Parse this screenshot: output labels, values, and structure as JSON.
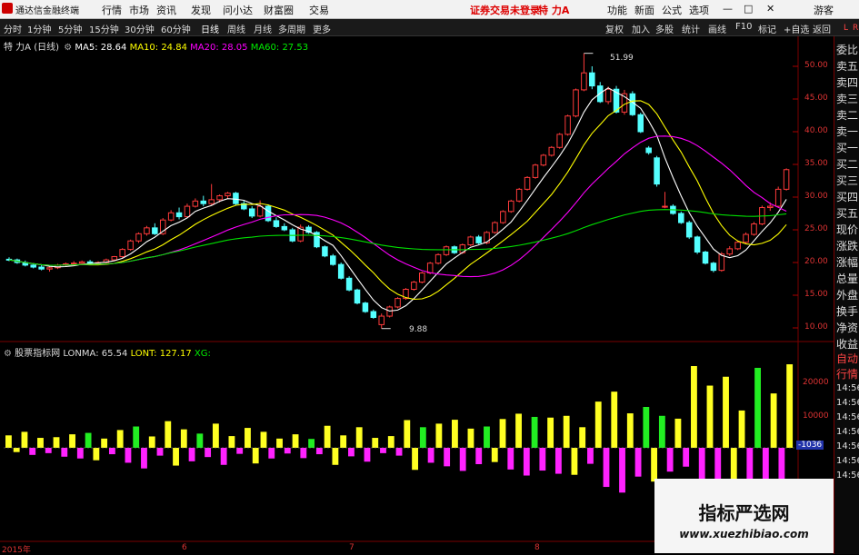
{
  "menubar": {
    "logo_text": "通达信金融终端",
    "items": [
      "行情",
      "市场",
      "资讯",
      "发现",
      "问小达",
      "财富圈",
      "交易"
    ],
    "notice": "证券交易未登录",
    "stock": "特 力A",
    "right_items": [
      "功能",
      "新面",
      "公式",
      "选项"
    ],
    "window_buttons": [
      "—",
      "□",
      "✕"
    ],
    "guest": "游客"
  },
  "toolbar": {
    "periods": [
      "分时",
      "1分钟",
      "5分钟",
      "15分钟",
      "30分钟",
      "60分钟",
      "日线",
      "周线",
      "月线",
      "多周期",
      "更多"
    ],
    "selected": "日线",
    "right_items": [
      "复权",
      "加入",
      "多股",
      "统计",
      "画线",
      "F10",
      "标记",
      "+自选",
      "返回"
    ]
  },
  "main_chart": {
    "stock_label": "特 力A",
    "period_label": "(日线)",
    "ma": [
      {
        "label": "MA5: 28.64",
        "color": "#ffffff"
      },
      {
        "label": "MA10: 24.84",
        "color": "#ffff00"
      },
      {
        "label": "MA20: 28.05",
        "color": "#ff00ff"
      },
      {
        "label": "MA60: 27.53",
        "color": "#00e000"
      }
    ],
    "y_ticks": [
      "50.00",
      "45.00",
      "40.00",
      "35.00",
      "30.00",
      "25.00",
      "20.00",
      "15.00",
      "10.00"
    ],
    "high_label": "51.99",
    "low_label": "9.88"
  },
  "indicator": {
    "name": "股票指标网",
    "lonma_label": "LONMA: 65.54",
    "lont_label": "LONT: 127.17",
    "xg_label": "XG:",
    "y_ticks": [
      "20000",
      "10000"
    ],
    "current_value": "-1036"
  },
  "x_labels": [
    "2015年",
    "6",
    "7",
    "8"
  ],
  "right_panel": {
    "top_letters": [
      "L",
      "R"
    ],
    "items": [
      "委比",
      "卖五",
      "卖四",
      "卖三",
      "卖二",
      "卖一",
      "买一",
      "买二",
      "买三",
      "买四",
      "买五",
      "现价",
      "涨跌",
      "涨幅",
      "总量",
      "外盘",
      "换手",
      "净资",
      "收益",
      "自动",
      "行情"
    ],
    "times": [
      "14:56",
      "14:56",
      "14:56",
      "14:56",
      "14:56",
      "14:56",
      "14:56"
    ]
  },
  "watermark": {
    "title": "指标严选网",
    "url": "www.xuezhibiao.com"
  },
  "chart_data": {
    "type": "candlestick",
    "price_range": [
      9.0,
      53.0
    ],
    "candles": [
      [
        20.5,
        20.8,
        20.2,
        20.4
      ],
      [
        20.4,
        20.6,
        19.8,
        20.0
      ],
      [
        20.0,
        20.3,
        19.4,
        19.6
      ],
      [
        19.6,
        19.9,
        19.1,
        19.3
      ],
      [
        19.3,
        19.6,
        18.8,
        19.0
      ],
      [
        19.0,
        19.4,
        18.6,
        19.2
      ],
      [
        19.2,
        19.8,
        19.0,
        19.6
      ],
      [
        19.6,
        20.0,
        19.4,
        19.8
      ],
      [
        19.8,
        20.2,
        19.5,
        19.9
      ],
      [
        19.9,
        20.3,
        19.6,
        20.1
      ],
      [
        20.1,
        20.4,
        19.7,
        19.9
      ],
      [
        19.9,
        20.2,
        19.6,
        20.0
      ],
      [
        20.0,
        20.6,
        19.8,
        20.4
      ],
      [
        20.4,
        21.0,
        20.2,
        20.9
      ],
      [
        20.9,
        22.2,
        20.7,
        22.0
      ],
      [
        22.0,
        23.5,
        21.8,
        23.3
      ],
      [
        23.3,
        24.6,
        23.0,
        24.4
      ],
      [
        24.4,
        25.6,
        24.1,
        25.3
      ],
      [
        25.3,
        26.0,
        24.2,
        24.4
      ],
      [
        24.4,
        26.8,
        24.2,
        26.5
      ],
      [
        26.5,
        28.0,
        26.3,
        27.6
      ],
      [
        27.6,
        28.4,
        26.6,
        27.0
      ],
      [
        27.0,
        29.0,
        26.8,
        28.6
      ],
      [
        28.6,
        29.8,
        28.4,
        29.4
      ],
      [
        29.4,
        30.2,
        28.6,
        29.0
      ],
      [
        29.0,
        32.0,
        28.8,
        29.6
      ],
      [
        29.6,
        30.4,
        29.2,
        30.2
      ],
      [
        30.2,
        30.8,
        29.8,
        30.6
      ],
      [
        30.6,
        30.8,
        28.7,
        29.0
      ],
      [
        29.0,
        29.5,
        28.0,
        28.2
      ],
      [
        28.2,
        28.6,
        26.8,
        27.1
      ],
      [
        27.1,
        29.5,
        26.9,
        28.6
      ],
      [
        28.6,
        28.9,
        26.2,
        26.4
      ],
      [
        26.4,
        26.9,
        25.3,
        25.5
      ],
      [
        25.5,
        26.0,
        24.8,
        25.0
      ],
      [
        25.0,
        25.3,
        23.1,
        23.3
      ],
      [
        23.3,
        25.8,
        23.1,
        25.4
      ],
      [
        25.4,
        25.7,
        24.4,
        24.6
      ],
      [
        24.6,
        24.8,
        22.2,
        22.4
      ],
      [
        22.4,
        22.6,
        20.8,
        21.0
      ],
      [
        21.0,
        21.3,
        19.5,
        19.7
      ],
      [
        19.7,
        20.0,
        17.4,
        17.6
      ],
      [
        17.6,
        17.9,
        15.6,
        15.8
      ],
      [
        15.8,
        16.0,
        13.6,
        13.8
      ],
      [
        13.8,
        14.0,
        12.3,
        12.5
      ],
      [
        12.5,
        12.8,
        11.4,
        11.6
      ],
      [
        10.5,
        12.2,
        9.9,
        11.8
      ],
      [
        11.8,
        13.4,
        11.6,
        13.2
      ],
      [
        13.2,
        14.7,
        13.0,
        14.5
      ],
      [
        14.5,
        16.1,
        14.3,
        15.9
      ],
      [
        15.9,
        17.2,
        15.7,
        17.0
      ],
      [
        17.0,
        18.6,
        16.8,
        18.4
      ],
      [
        18.4,
        20.1,
        18.2,
        19.9
      ],
      [
        19.9,
        21.4,
        19.7,
        21.2
      ],
      [
        21.2,
        22.6,
        21.0,
        22.4
      ],
      [
        22.4,
        22.6,
        21.3,
        21.5
      ],
      [
        21.5,
        22.9,
        21.3,
        22.7
      ],
      [
        22.7,
        24.1,
        22.5,
        23.9
      ],
      [
        23.9,
        24.2,
        22.8,
        23.0
      ],
      [
        23.0,
        24.8,
        22.8,
        24.6
      ],
      [
        24.6,
        26.3,
        24.4,
        26.1
      ],
      [
        26.1,
        28.0,
        25.9,
        27.8
      ],
      [
        27.8,
        29.6,
        27.6,
        29.4
      ],
      [
        29.4,
        31.4,
        29.2,
        31.2
      ],
      [
        31.2,
        33.2,
        31.0,
        33.0
      ],
      [
        33.0,
        35.1,
        32.8,
        34.9
      ],
      [
        34.9,
        36.6,
        34.7,
        36.4
      ],
      [
        36.4,
        37.8,
        36.2,
        37.6
      ],
      [
        37.6,
        39.8,
        37.4,
        39.6
      ],
      [
        39.6,
        42.6,
        39.4,
        42.4
      ],
      [
        42.4,
        46.6,
        42.2,
        46.4
      ],
      [
        46.4,
        51.99,
        46.2,
        49.0
      ],
      [
        49.0,
        50.0,
        46.5,
        47.0
      ],
      [
        47.0,
        47.6,
        44.4,
        44.6
      ],
      [
        44.6,
        46.9,
        44.2,
        46.5
      ],
      [
        46.5,
        47.0,
        42.8,
        43.0
      ],
      [
        43.0,
        46.4,
        42.6,
        45.8
      ],
      [
        45.8,
        46.2,
        42.4,
        42.6
      ],
      [
        42.6,
        42.9,
        39.8,
        40.0
      ],
      [
        37.5,
        37.8,
        36.5,
        36.8
      ],
      [
        36.0,
        36.3,
        31.6,
        32.0
      ],
      [
        28.5,
        30.8,
        28.3,
        28.6
      ],
      [
        28.6,
        28.9,
        27.3,
        27.5
      ],
      [
        27.5,
        27.8,
        25.9,
        26.1
      ],
      [
        26.1,
        26.4,
        23.6,
        23.9
      ],
      [
        23.9,
        24.1,
        21.3,
        21.6
      ],
      [
        21.6,
        21.8,
        19.7,
        19.9
      ],
      [
        19.9,
        20.1,
        18.5,
        18.8
      ],
      [
        18.8,
        21.6,
        18.6,
        21.3
      ],
      [
        21.3,
        22.5,
        21.0,
        22.1
      ],
      [
        22.1,
        23.4,
        21.9,
        23.1
      ],
      [
        23.1,
        24.6,
        22.8,
        24.3
      ],
      [
        24.3,
        26.2,
        24.1,
        25.9
      ],
      [
        25.9,
        28.7,
        25.7,
        28.4
      ],
      [
        28.4,
        29.2,
        27.9,
        28.6
      ],
      [
        28.6,
        31.6,
        28.4,
        31.2
      ],
      [
        31.2,
        34.4,
        31.0,
        34.2
      ]
    ],
    "indicator_values": [
      3500,
      -1200,
      4500,
      -2000,
      2800,
      -1500,
      3000,
      -2500,
      3800,
      -3000,
      4200,
      -3500,
      2600,
      -1800,
      5000,
      -4200,
      6000,
      -5800,
      3200,
      -2200,
      7500,
      -5000,
      5200,
      -3800,
      4000,
      -2600,
      6800,
      -4800,
      3300,
      -1700,
      5600,
      -4400,
      4500,
      -3000,
      2600,
      -1600,
      3800,
      -2900,
      2500,
      -1800,
      6200,
      -4800,
      3500,
      -2400,
      5800,
      -3900,
      2800,
      -1500,
      3300,
      -2200,
      7800,
      -6200,
      5800,
      -4200,
      6800,
      -5200,
      7900,
      -6500,
      5400,
      -4600,
      6000,
      -4000,
      8100,
      -6100,
      9600,
      -7800,
      8700,
      -6400,
      8500,
      -7300,
      9000,
      -7600,
      5800,
      -4500,
      13000,
      -11000,
      15800,
      -12600,
      9700,
      -8100,
      11500,
      -9500,
      9000,
      -6700,
      8200,
      -5300,
      23000,
      -15600,
      17500,
      -13800,
      20000,
      -14700,
      10500,
      -8800,
      22500,
      -17300,
      15300,
      -9900,
      23500
    ],
    "indicator_range": [
      -25000,
      27000
    ]
  }
}
